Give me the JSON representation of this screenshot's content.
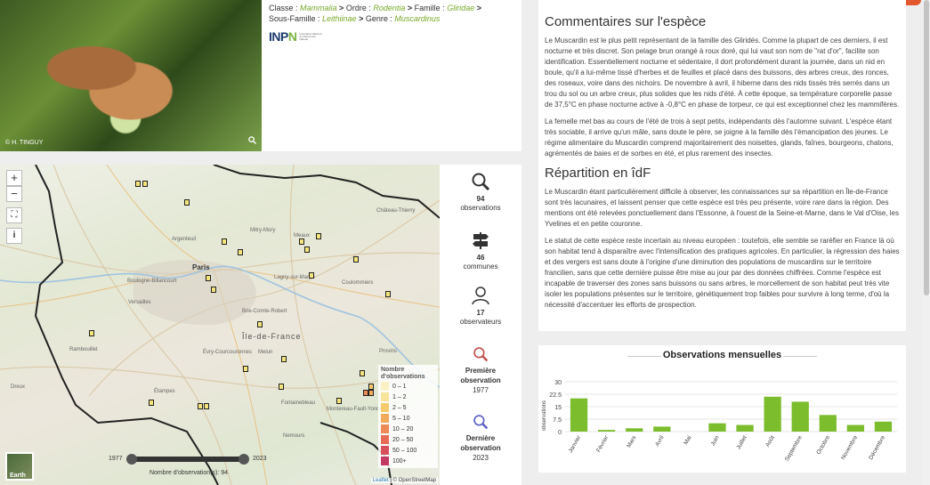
{
  "photo": {
    "credit": "© H. TINGUY"
  },
  "taxonomy": {
    "classe_label": "Classe : ",
    "classe": "Mammalia",
    "ordre_label": "Ordre : ",
    "ordre": "Rodentia",
    "famille_label": "Famille : ",
    "famille": "Gliridae",
    "sousfamille_label": "Sous-Famille : ",
    "sousfamille": "Leithiinae",
    "genre_label": "Genre : ",
    "genre": "Muscardinus",
    "inpn_logo_a": "INP",
    "inpn_logo_b": "N",
    "inpn_tagline": "Inventaire National du Patrimoine Naturel"
  },
  "map": {
    "zoom_in": "+",
    "zoom_out": "−",
    "cities": [
      {
        "name": "Argenteuil"
      },
      {
        "name": "Paris"
      },
      {
        "name": "Boulogne-Billancourt"
      },
      {
        "name": "Meaux"
      },
      {
        "name": "Château-Thierry"
      },
      {
        "name": "Mitry-Mory"
      },
      {
        "name": "Lagny-sur-Marne"
      },
      {
        "name": "Coulommiers"
      },
      {
        "name": "Versailles"
      },
      {
        "name": "Brie-Comte-Robert"
      },
      {
        "name": "Étampes"
      },
      {
        "name": "Fontainebleau"
      },
      {
        "name": "Montereau-Fault-Yonne"
      },
      {
        "name": "Nemours"
      },
      {
        "name": "Provins"
      },
      {
        "name": "Rambouillet"
      },
      {
        "name": "Évry-Courcouronnes"
      },
      {
        "name": "Dreux"
      },
      {
        "name": "Melun"
      }
    ],
    "region_label": "Île-de-France",
    "legend_title": "Nombre d'observations",
    "legend": [
      {
        "label": "0 – 1",
        "color": "#fbf1c6"
      },
      {
        "label": "1 – 2",
        "color": "#f8e49a"
      },
      {
        "label": "2 – 5",
        "color": "#f5cb6e"
      },
      {
        "label": "5 – 10",
        "color": "#f2aa5c"
      },
      {
        "label": "10 – 20",
        "color": "#ee8a55"
      },
      {
        "label": "20 – 50",
        "color": "#e76b56"
      },
      {
        "label": "50 – 100",
        "color": "#d84f5c"
      },
      {
        "label": "100+",
        "color": "#c23a5f"
      }
    ],
    "slider_start": "1977",
    "slider_end": "2023",
    "slider_count": "Nombre d'observation(s): 94",
    "earth_label": "Earth",
    "attrib_leaflet": "Leaflet",
    "attrib_osm": " | © OpenStreetMap"
  },
  "stats": {
    "observations_num": "94",
    "observations_label": "observations",
    "communes_num": "46",
    "communes_label": "communes",
    "observateurs_num": "17",
    "observateurs_label": "observateurs",
    "premiere_label_1": "Première",
    "premiere_label_2": "observation",
    "premiere_year": "1977",
    "derniere_label_1": "Dernière",
    "derniere_label_2": "observation",
    "derniere_year": "2023"
  },
  "comments": {
    "title": "Commentaires sur l'espèce",
    "p1": "Le Muscardin est le plus petit représentant de la famille des Gliridés. Comme la plupart de ces derniers, il est nocturne et très discret. Son pelage brun orangé à roux doré, qui lui vaut son nom de \"rat d'or\", facilite son identification. Essentiellement nocturne et sédentaire, il dort profondément durant la journée, dans un nid en boule, qu'il a lui-même tissé d'herbes et de feuilles et placé dans des buissons, des arbres creux, des ronces, des roseaux, voire dans des nichoirs. De novembre à avril, il hiberne dans des nids tissés très serrés dans un trou du sol ou un arbre creux, plus solides que les nids d'été. À cette époque, sa température corporelle passe de 37,5°C en phase nocturne active à -0,8°C en phase de torpeur, ce qui est exceptionnel chez les mammifères.",
    "p2": "La femelle met bas au cours de l'été de trois à sept petits, indépendants dès l'automne suivant. L'espèce étant très sociable, il arrive qu'un mâle, sans doute le père, se joigne à la famille dès l'émancipation des jeunes. Le régime alimentaire du Muscardin comprend majoritairement des noisettes, glands, faînes, bourgeons, chatons, agrémentés de baies et de sorbes en été, et plus rarement des insectes."
  },
  "repartition": {
    "title": "Répartition en îdF",
    "p1": "Le Muscardin étant particulièrement difficile à observer, les connaissances sur sa répartition en Île-de-France sont très lacunaires, et laissent penser que cette espèce est très peu présente, voire rare dans la région. Des mentions ont été relevées ponctuellement dans l'Essonne, à l'ouest de la Seine-et-Marne, dans le Val d'Oise, les Yvelines et en petite couronne.",
    "p2": "Le statut de cette espèce reste incertain au niveau européen : toutefois, elle semble se raréfier en France là où son habitat tend à disparaître avec l'intensification des pratiques agricoles. En particulier, la régression des haies et des vergers est sans doute à l'origine d'une diminution des populations de muscardins sur le territoire francilien, sans que cette dernière puisse être mise au jour par des données chiffrées. Comme l'espèce est incapable de traverser des zones sans buissons ou sans arbres, le morcellement de son habitat peut très vite isoler les populations présentes sur le territoire, génétiquement trop faibles pour survivre à long terme, d'où la nécessité d'accentuer les efforts de prospection."
  },
  "chart_data": {
    "type": "bar",
    "title": "Observations mensuelles",
    "ylabel": "observations",
    "xlabel": "",
    "categories": [
      "Janvier",
      "Février",
      "Mars",
      "Avril",
      "Mai",
      "Juin",
      "Juillet",
      "Août",
      "Septembre",
      "Octobre",
      "Novembre",
      "Décembre"
    ],
    "values": [
      20,
      1,
      2,
      3,
      0,
      5,
      4,
      21,
      18,
      10,
      4,
      6
    ],
    "ylim": [
      0,
      30
    ],
    "yticks": [
      "0",
      "7.5",
      "15",
      "22.5",
      "30"
    ],
    "color": "#7cbd2e",
    "grid": true
  }
}
